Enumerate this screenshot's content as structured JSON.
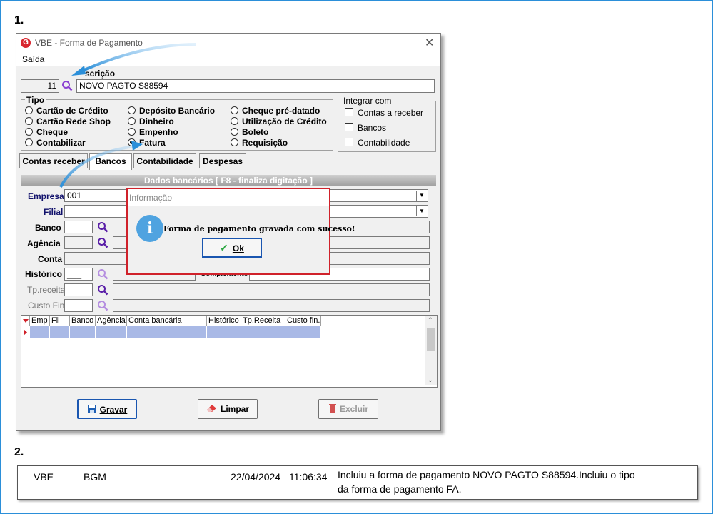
{
  "steps": {
    "first": "1.",
    "second": "2."
  },
  "window": {
    "title": "VBE - Forma de Pagamento",
    "menu": "Saída"
  },
  "header": {
    "code": "11",
    "description_label": "scrição",
    "description_value": "NOVO PAGTO S88594"
  },
  "tipo": {
    "label": "Tipo",
    "options": [
      "Cartão de Crédito",
      "Cartão Rede Shop",
      "Cheque",
      "Contabilizar",
      "Depósito Bancário",
      "Dinheiro",
      "Empenho",
      "Fatura",
      "Cheque pré-datado",
      "Utilização de Crédito",
      "Boleto",
      "Requisição"
    ],
    "selected": "Fatura"
  },
  "integrar": {
    "label": "Integrar com",
    "options": [
      "Contas a receber",
      "Bancos",
      "Contabilidade"
    ]
  },
  "tabs": [
    "Contas receber",
    "Bancos",
    "Contabilidade",
    "Despesas"
  ],
  "active_tab": "Bancos",
  "bank_panel": {
    "header": "Dados bancários [ F8 - finaliza digitação ]",
    "empresa_label": "Empresa",
    "empresa_value": "001",
    "filial_label": "Filial",
    "banco_label": "Banco",
    "agencia_label": "Agência",
    "conta_label": "Conta",
    "historico_label": "Histórico",
    "historico_value": "___",
    "complemento_label": "Complemento",
    "tpreceita_label": "Tp.receita",
    "custofin_label": "Custo Fin."
  },
  "grid_columns": [
    "Emp",
    "Fil",
    "Banco",
    "Agência",
    "Conta bancária",
    "Histórico",
    "Tp.Receita",
    "Custo fin."
  ],
  "buttons": {
    "save": "Gravar",
    "clear": "Limpar",
    "delete": "Excluir"
  },
  "dialog": {
    "title": "Informação",
    "message": "Forma de pagamento gravada com sucesso!",
    "ok": "Ok"
  },
  "log": {
    "system": "VBE",
    "user": "BGM",
    "date": "22/04/2024",
    "time": "11:06:34",
    "line1": "Incluiu a forma de pagamento NOVO PAGTO S88594.Incluiu o tipo",
    "line2": "da forma de pagamento FA."
  },
  "colors": {
    "accent": "#2b8fd9",
    "selection": "#a9b9e6",
    "dialog_border": "#d0212a",
    "info": "#4fa3e0"
  }
}
